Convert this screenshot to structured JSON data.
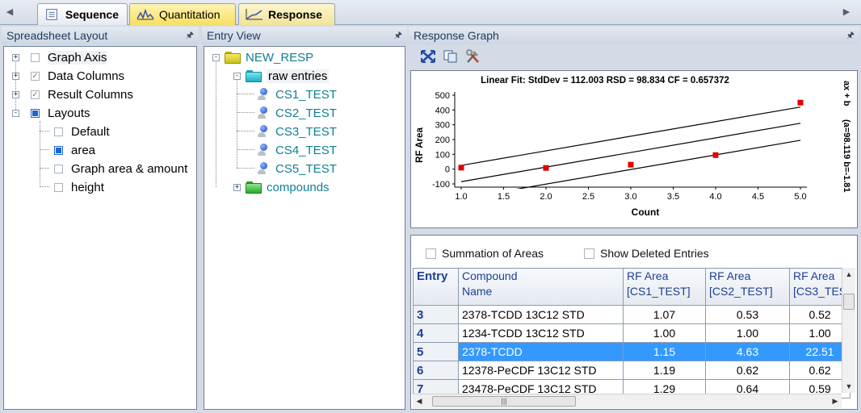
{
  "tabs": [
    {
      "label": "Sequence",
      "icon": "sequence-icon"
    },
    {
      "label": "Quantitation",
      "icon": "quantitation-icon"
    },
    {
      "label": "Response",
      "icon": "response-icon"
    }
  ],
  "spreadsheet_layout": {
    "title": "Spreadsheet Layout",
    "items": [
      {
        "label": "Graph Axis",
        "checked": false,
        "expander": "+"
      },
      {
        "label": "Data Columns",
        "checked": true,
        "expander": "+"
      },
      {
        "label": "Result Columns",
        "checked": true,
        "expander": "+"
      },
      {
        "label": "Layouts",
        "checked": "filled",
        "expander": "-"
      },
      {
        "label": "Default",
        "checked": false
      },
      {
        "label": "area",
        "checked": "filled"
      },
      {
        "label": "Graph area & amount",
        "checked": false
      },
      {
        "label": "height",
        "checked": false
      }
    ]
  },
  "entry_view": {
    "title": "Entry View",
    "root": "NEW_RESP",
    "raw_entries": "raw entries",
    "entries": [
      "CS1_TEST",
      "CS2_TEST",
      "CS3_TEST",
      "CS4_TEST",
      "CS5_TEST"
    ],
    "compounds": "compounds"
  },
  "response_graph": {
    "title": "Response Graph",
    "right_label_top": "ax + b",
    "right_label_side": "(a=98.119 b=-1.81"
  },
  "chart_data": {
    "type": "scatter",
    "title": "Linear Fit: StdDev = 112.003 RSD = 98.834 CF = 0.657372",
    "xlabel": "Count",
    "ylabel": "RF Area",
    "xlim": [
      1.0,
      5.0
    ],
    "ylim": [
      -100,
      500
    ],
    "xticks": [
      "1.0",
      "1.5",
      "2.0",
      "2.5",
      "3.0",
      "3.5",
      "4.0",
      "4.5",
      "5.0"
    ],
    "yticks": [
      "-100",
      "0",
      "100",
      "200",
      "300",
      "400",
      "500"
    ],
    "points": [
      {
        "x": 1.0,
        "y": 10
      },
      {
        "x": 2.0,
        "y": 8
      },
      {
        "x": 3.0,
        "y": 30
      },
      {
        "x": 4.0,
        "y": 95
      },
      {
        "x": 5.0,
        "y": 450
      }
    ],
    "fit_lines": [
      {
        "name": "upper",
        "x": [
          1.0,
          5.0
        ],
        "y": [
          25,
          420
        ]
      },
      {
        "name": "fit",
        "x": [
          1.0,
          5.0
        ],
        "y": [
          -85,
          310
        ]
      },
      {
        "name": "lower",
        "x": [
          1.0,
          5.0
        ],
        "y": [
          -200,
          195
        ]
      }
    ],
    "point_color": "#e00000",
    "line_color": "#000000"
  },
  "grid": {
    "options": [
      {
        "label": "Summation of Areas",
        "checked": false
      },
      {
        "label": "Show Deleted Entries",
        "checked": false
      }
    ],
    "columns": [
      {
        "line1": "Entry",
        "line2": ""
      },
      {
        "line1": "Compound",
        "line2": "Name"
      },
      {
        "line1": "RF Area",
        "line2": "[CS1_TEST]"
      },
      {
        "line1": "RF Area",
        "line2": "[CS2_TEST]"
      },
      {
        "line1": "RF Area",
        "line2": "[CS3_TES"
      }
    ],
    "rows": [
      {
        "entry": "3",
        "name": "2378-TCDD 13C12 STD",
        "cs1": "1.07",
        "cs2": "0.53",
        "cs3": "0.52"
      },
      {
        "entry": "4",
        "name": "1234-TCDD 13C12 STD",
        "cs1": "1.00",
        "cs2": "1.00",
        "cs3": "1.00"
      },
      {
        "entry": "5",
        "name": "2378-TCDD",
        "cs1": "1.15",
        "cs2": "4.63",
        "cs3": "22.51"
      },
      {
        "entry": "6",
        "name": "12378-PeCDF 13C12 STD",
        "cs1": "1.19",
        "cs2": "0.62",
        "cs3": "0.62"
      },
      {
        "entry": "7",
        "name": "23478-PeCDF 13C12 STD",
        "cs1": "1.29",
        "cs2": "0.64",
        "cs3": "0.59"
      }
    ],
    "selected_row_index": 2
  }
}
